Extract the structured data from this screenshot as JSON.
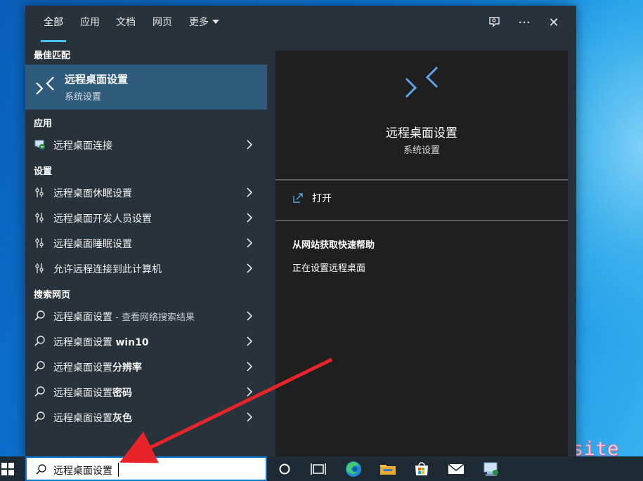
{
  "tabs": [
    {
      "label": "全部",
      "active": true
    },
    {
      "label": "应用"
    },
    {
      "label": "文档"
    },
    {
      "label": "网页"
    },
    {
      "label": "更多"
    }
  ],
  "top_buttons": {
    "feedback_icon": "feedback-icon",
    "more": "···",
    "close": "✕"
  },
  "best_match": {
    "header": "最佳匹配",
    "title": "远程桌面设置",
    "subtitle": "系统设置",
    "icon": "remote-desktop-icon"
  },
  "apps": {
    "header": "应用",
    "items": [
      {
        "label": "远程桌面连接",
        "icon": "remote-desktop-connection-icon"
      }
    ]
  },
  "settings": {
    "header": "设置",
    "items": [
      {
        "label": "远程桌面休眠设置",
        "icon": "settings-sliders-icon"
      },
      {
        "label": "远程桌面开发人员设置",
        "icon": "settings-sliders-icon"
      },
      {
        "label": "远程桌面睡眠设置",
        "icon": "settings-sliders-icon"
      },
      {
        "label": "允许远程连接到此计算机",
        "icon": "settings-sliders-icon"
      }
    ]
  },
  "web": {
    "header": "搜索网页",
    "items": [
      {
        "prefix": "远程桌面设置",
        "suffix": " - 查看网络搜索结果",
        "suffix_muted": true
      },
      {
        "prefix": "远程桌面设置 ",
        "suffix": "win10"
      },
      {
        "prefix": "远程桌面设置",
        "suffix": "分辨率"
      },
      {
        "prefix": "远程桌面设置",
        "suffix": "密码"
      },
      {
        "prefix": "远程桌面设置",
        "suffix": "灰色"
      }
    ]
  },
  "preview": {
    "title": "远程桌面设置",
    "subtitle": "系统设置",
    "open_label": "打开",
    "help_header": "从网站获取快速帮助",
    "help_link": "正在设置远程桌面"
  },
  "taskbar": {
    "search_value": "远程桌面设置",
    "icons": [
      "windows-start-icon",
      "cortana-icon",
      "task-view-icon",
      "edge-icon",
      "file-explorer-icon",
      "store-icon",
      "mail-icon",
      "remote-desktop-taskbar-icon"
    ]
  },
  "watermark": "www.hikki.site",
  "colors": {
    "accent": "#4cc2ff",
    "selected_row": "#2e5a7c",
    "pane_left": "#27323a",
    "pane_right": "#1f1f1f",
    "arrow": "#e8232a"
  }
}
